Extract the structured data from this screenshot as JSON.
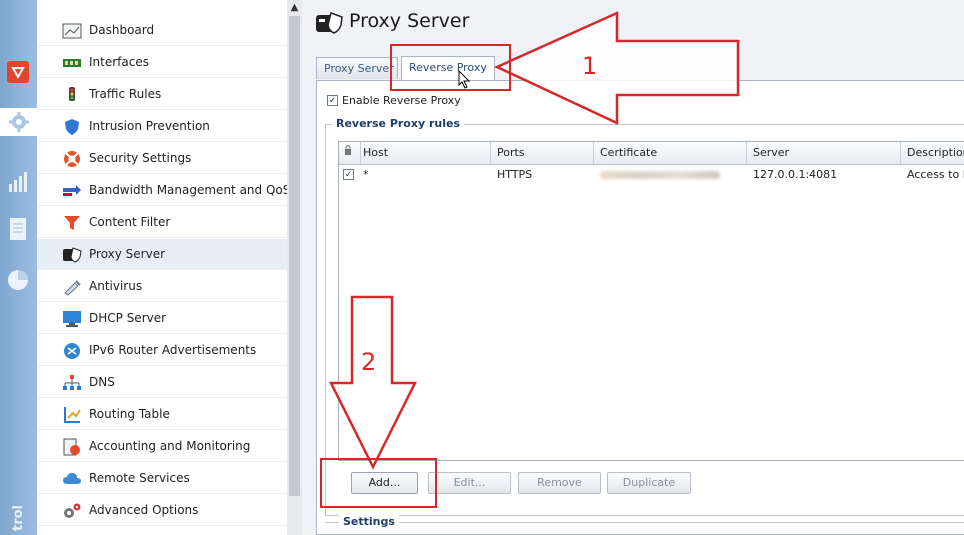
{
  "rail": {
    "vertical_text": "trol",
    "icons": [
      "shield-icon",
      "gear-icon",
      "bar-chart-icon",
      "document-icon",
      "pie-chart-icon"
    ]
  },
  "sidebar": {
    "items": [
      {
        "label": "Dashboard",
        "icon": "dashboard-icon"
      },
      {
        "label": "Interfaces",
        "icon": "network-card-icon"
      },
      {
        "label": "Traffic Rules",
        "icon": "traffic-light-icon"
      },
      {
        "label": "Intrusion Prevention",
        "icon": "shield-icon"
      },
      {
        "label": "Security Settings",
        "icon": "lifebuoy-icon"
      },
      {
        "label": "Bandwidth Management and QoS",
        "icon": "bandwidth-arrows-icon"
      },
      {
        "label": "Content Filter",
        "icon": "funnel-icon"
      },
      {
        "label": "Proxy Server",
        "icon": "proxy-server-icon"
      },
      {
        "label": "Antivirus",
        "icon": "syringe-icon"
      },
      {
        "label": "DHCP Server",
        "icon": "monitor-icon"
      },
      {
        "label": "IPv6 Router Advertisements",
        "icon": "ipv6-icon"
      },
      {
        "label": "DNS",
        "icon": "dns-tree-icon"
      },
      {
        "label": "Routing Table",
        "icon": "routing-icon"
      },
      {
        "label": "Accounting and Monitoring",
        "icon": "accounting-icon"
      },
      {
        "label": "Remote Services",
        "icon": "cloud-icon"
      },
      {
        "label": "Advanced Options",
        "icon": "gears-icon"
      }
    ],
    "active_index": 7
  },
  "main": {
    "title": "Proxy Server",
    "tabs": [
      {
        "label": "Proxy Server"
      },
      {
        "label": "Reverse Proxy"
      }
    ],
    "active_tab": 1,
    "enable_label": "Enable Reverse Proxy",
    "enable_checked": true,
    "rules_group_title": "Reverse Proxy rules",
    "table": {
      "headers": [
        "Host",
        "Ports",
        "Certificate",
        "Server",
        "Description"
      ],
      "rows": [
        {
          "host": "*",
          "ports": "HTTPS",
          "certificate": "",
          "server": "127.0.0.1:4081",
          "description": "Access to K"
        }
      ]
    },
    "buttons": {
      "add": "Add...",
      "edit": "Edit...",
      "remove": "Remove",
      "duplicate": "Duplicate"
    },
    "settings_title": "Settings"
  },
  "annotations": {
    "step1": "1",
    "step2": "2",
    "color": "#d62828"
  }
}
